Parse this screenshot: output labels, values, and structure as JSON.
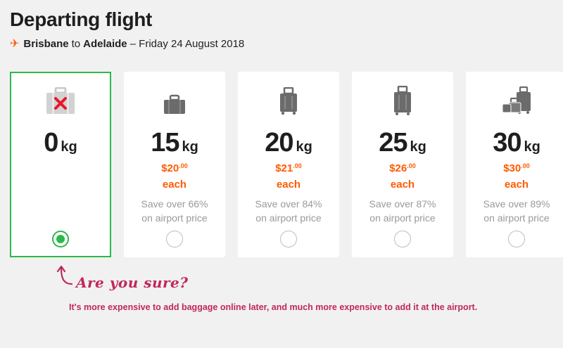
{
  "header": {
    "title": "Departing flight",
    "origin": "Brisbane",
    "to_word": "to",
    "destination": "Adelaide",
    "date": "– Friday 24 August 2018"
  },
  "options": [
    {
      "weight": "0",
      "unit": "kg",
      "icon": "no-bag-icon",
      "selected": true
    },
    {
      "weight": "15",
      "unit": "kg",
      "icon": "small-bag-icon",
      "price_dollars": "$20",
      "price_cents": ".00",
      "each": "each",
      "save_line1": "Save over 66%",
      "save_line2": "on airport price",
      "selected": false
    },
    {
      "weight": "20",
      "unit": "kg",
      "icon": "suitcase-icon",
      "price_dollars": "$21",
      "price_cents": ".00",
      "each": "each",
      "save_line1": "Save over 84%",
      "save_line2": "on airport price",
      "selected": false
    },
    {
      "weight": "25",
      "unit": "kg",
      "icon": "large-suitcase-icon",
      "price_dollars": "$26",
      "price_cents": ".00",
      "each": "each",
      "save_line1": "Save over 87%",
      "save_line2": "on airport price",
      "selected": false
    },
    {
      "weight": "30",
      "unit": "kg",
      "icon": "multiple-bags-icon",
      "price_dollars": "$30",
      "price_cents": ".00",
      "each": "each",
      "save_line1": "Save over 89%",
      "save_line2": "on airport price",
      "selected": false
    }
  ],
  "warning": {
    "title": "Are you sure?",
    "text": "It's more expensive to add baggage online later, and much more expensive to add it at the airport."
  },
  "colors": {
    "accent_orange": "#ff5a00",
    "selected_green": "#2db84b",
    "warning_magenta": "#c0285a"
  }
}
